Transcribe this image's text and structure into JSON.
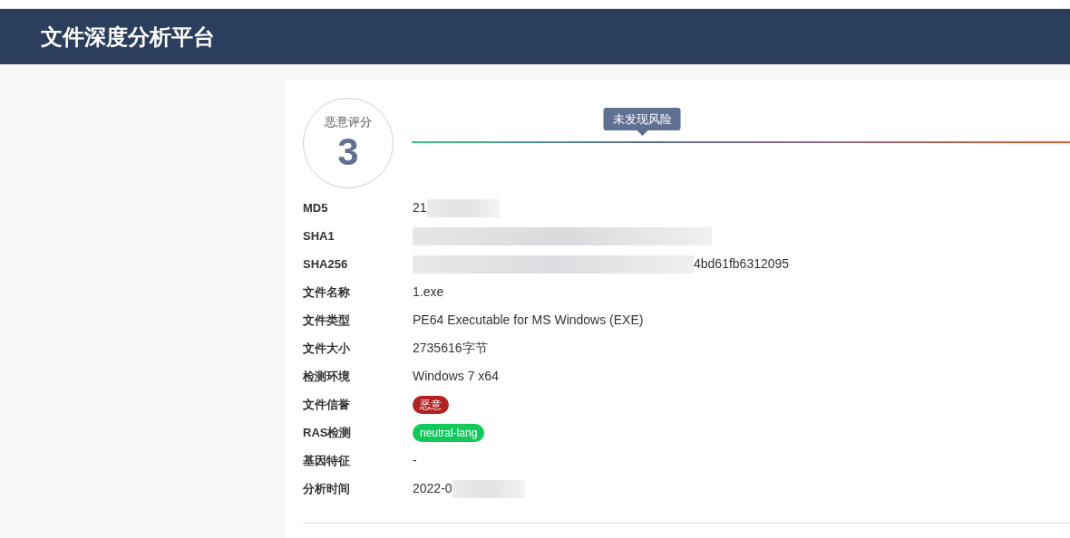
{
  "header": {
    "title": "文件深度分析平台"
  },
  "score": {
    "label": "恶意评分",
    "value": "3",
    "verdict": "未发现风险",
    "level": 0.35
  },
  "details": [
    {
      "kind": "redacted",
      "label": "MD5",
      "value": "21"
    },
    {
      "kind": "redacted",
      "label": "SHA1"
    },
    {
      "kind": "redacted",
      "label": "SHA256",
      "tail": "4bd61fb6312095"
    },
    {
      "kind": "text",
      "label": "文件名称",
      "value": "1.exe"
    },
    {
      "kind": "text",
      "label": "文件类型",
      "value": "PE64 Executable for MS Windows (EXE)"
    },
    {
      "kind": "text",
      "label": "文件大小",
      "value": "2735616字节"
    },
    {
      "kind": "text",
      "label": "检测环境",
      "value": "Windows 7 x64"
    },
    {
      "kind": "tag",
      "label": "文件信誉",
      "value": "恶意",
      "color": "#b22222"
    },
    {
      "kind": "tag",
      "label": "RAS检测",
      "value": "neutral-lang",
      "color": "#13c95e"
    },
    {
      "kind": "text",
      "label": "基因特征",
      "value": "-"
    },
    {
      "kind": "redacted",
      "label": "分析时间",
      "value": "2022-0"
    }
  ]
}
